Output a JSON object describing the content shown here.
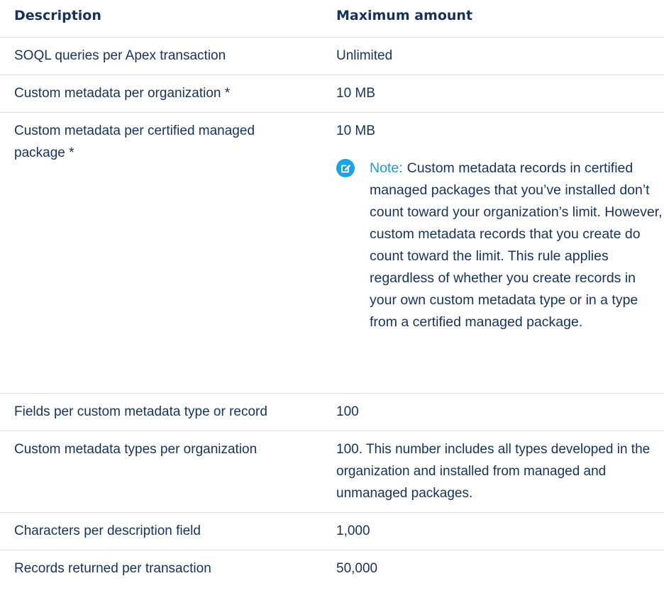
{
  "header": {
    "col_description": "Description",
    "col_maximum": "Maximum amount"
  },
  "rows": [
    {
      "description": "SOQL queries per Apex transaction",
      "maximum": "Unlimited"
    },
    {
      "description": "Custom metadata per organization *",
      "maximum": "10 MB"
    },
    {
      "description": "Custom metadata per certified managed package *",
      "maximum": "10 MB",
      "note": {
        "icon": "edit-note-icon",
        "label": "Note:",
        "text": "Custom metadata records in certified managed packages that you’ve installed don’t count toward your organization’s limit. However, custom metadata records that you create do count toward the limit. This rule applies regardless of whether you create records in your own custom metadata type or in a type from a certified managed package."
      }
    },
    {
      "description": "Fields per custom metadata type or record",
      "maximum": "100"
    },
    {
      "description": "Custom metadata types per organization",
      "maximum": "100. This number includes all types developed in the organization and installed from managed and unmanaged packages."
    },
    {
      "description": "Characters per description field",
      "maximum": "1,000"
    },
    {
      "description": "Records returned per transaction",
      "maximum": "50,000"
    }
  ],
  "colors": {
    "text": "#16325c",
    "note_accent": "#1fa3e0",
    "divider": "#d8dde6"
  }
}
